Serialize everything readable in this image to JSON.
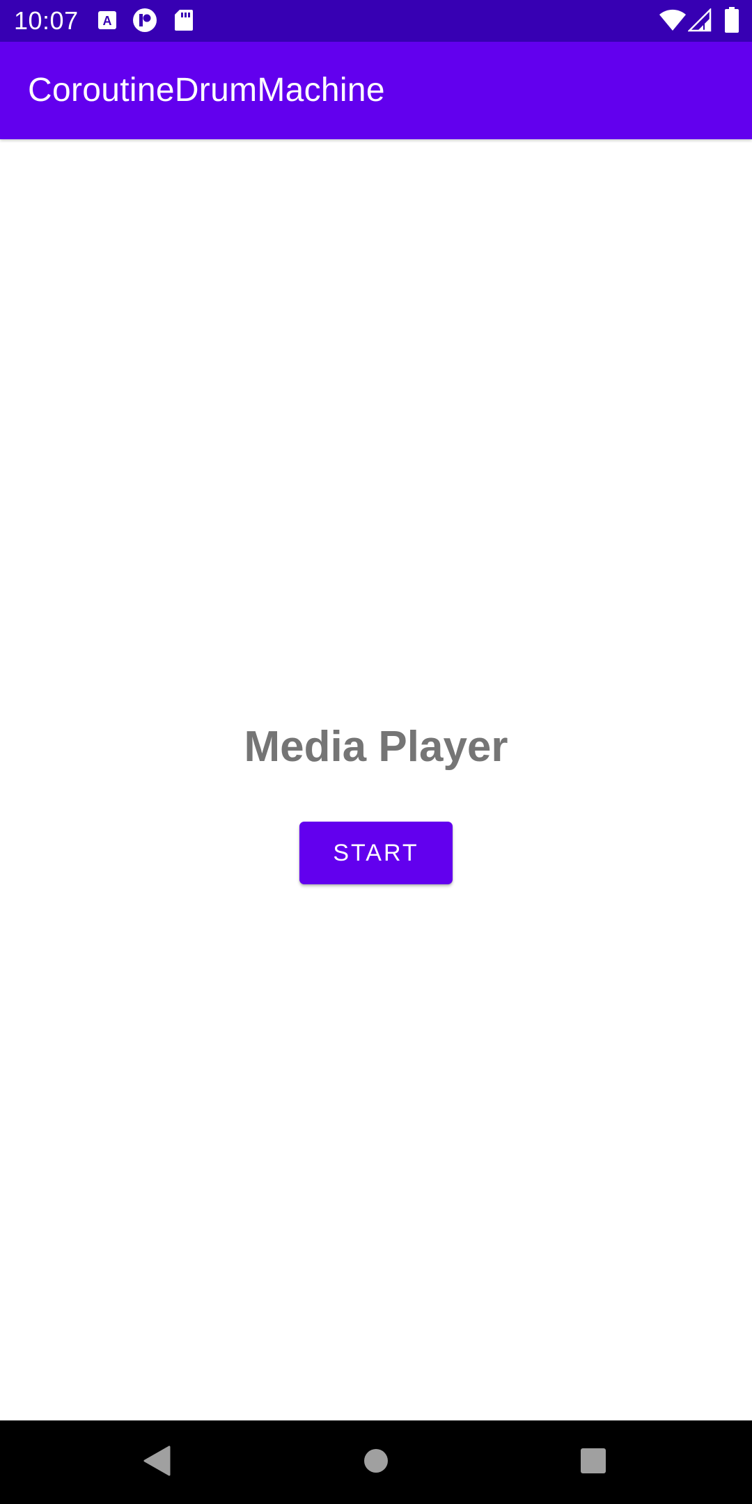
{
  "status_bar": {
    "time": "10:07",
    "background": "#3700b3",
    "icons": [
      "notification-a-icon",
      "notification-p-icon",
      "sd-card-icon",
      "wifi-icon",
      "cell-signal-icon",
      "battery-icon"
    ]
  },
  "app_bar": {
    "title": "CoroutineDrumMachine",
    "background": "#6200ee"
  },
  "main": {
    "headline": "Media Player",
    "headline_color": "#757575",
    "start_button_label": "START",
    "button_color": "#6200ee"
  },
  "nav_bar": {
    "icons": [
      "back-icon",
      "home-icon",
      "recents-icon"
    ]
  }
}
